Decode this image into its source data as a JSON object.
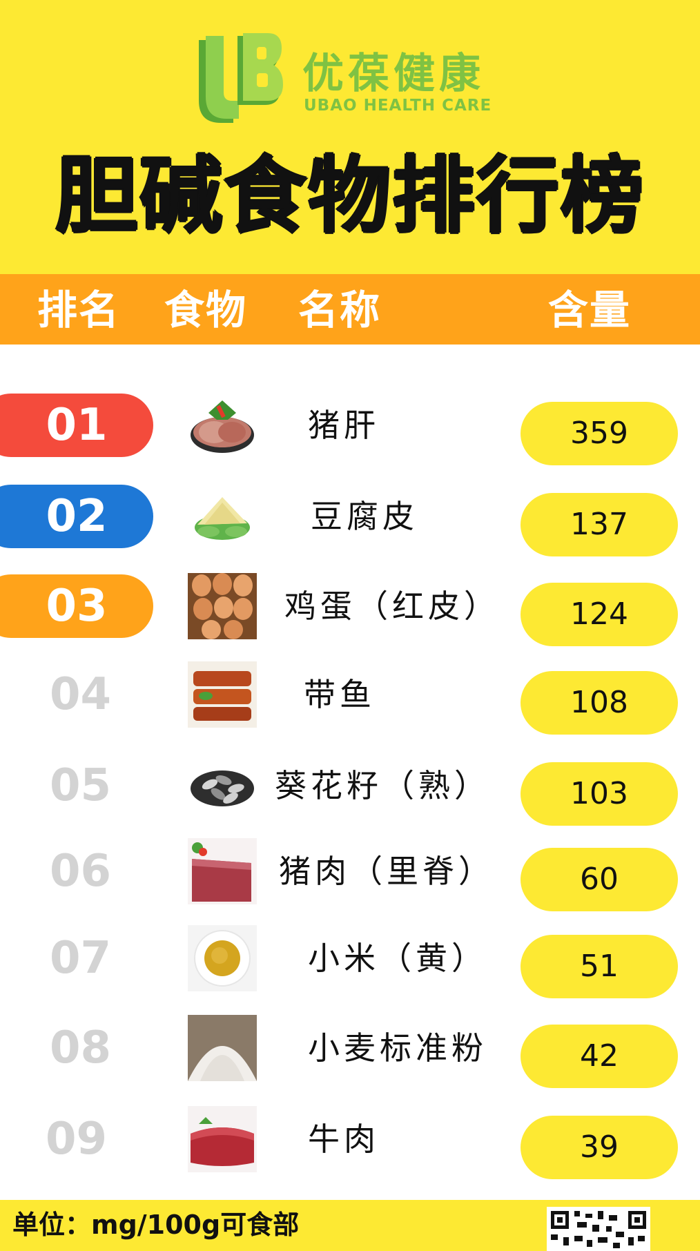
{
  "brand": {
    "name_cn": "优葆健康",
    "name_en": "UBAO HEALTH CARE",
    "logo_letters": "UB"
  },
  "title": "胆碱食物排行榜",
  "header": {
    "rank_label": "排名",
    "food_label": "食物",
    "name_label": "名称",
    "amount_label": "含量"
  },
  "colors": {
    "background_top": "#fde933",
    "header_bar": "#ffa31a",
    "rank1": "#f44b3c",
    "rank2": "#1e78d6",
    "rank3": "#ffa31a",
    "rank_other": "#d3d3d3",
    "value_pill": "#fde933",
    "logo_green": "#7fc243"
  },
  "rows": [
    {
      "rank": "01",
      "name": "猪肝",
      "value": "359",
      "icon": "pork-liver-image"
    },
    {
      "rank": "02",
      "name": "豆腐皮",
      "value": "137",
      "icon": "tofu-skin-image"
    },
    {
      "rank": "03",
      "name": "鸡蛋（红皮）",
      "value": "124",
      "icon": "eggs-image"
    },
    {
      "rank": "04",
      "name": "带鱼",
      "value": "108",
      "icon": "hairtail-fish-image"
    },
    {
      "rank": "05",
      "name": "葵花籽（熟）",
      "value": "103",
      "icon": "sunflower-seeds-image"
    },
    {
      "rank": "06",
      "name": "猪肉（里脊）",
      "value": "60",
      "icon": "pork-tenderloin-image"
    },
    {
      "rank": "07",
      "name": "小米（黄）",
      "value": "51",
      "icon": "millet-image"
    },
    {
      "rank": "08",
      "name": "小麦标准粉",
      "value": "42",
      "icon": "wheat-flour-image"
    },
    {
      "rank": "09",
      "name": "牛肉",
      "value": "39",
      "icon": "beef-image"
    }
  ],
  "footer": {
    "unit": "单位：mg/100g可食部",
    "qr": "qr-code"
  }
}
